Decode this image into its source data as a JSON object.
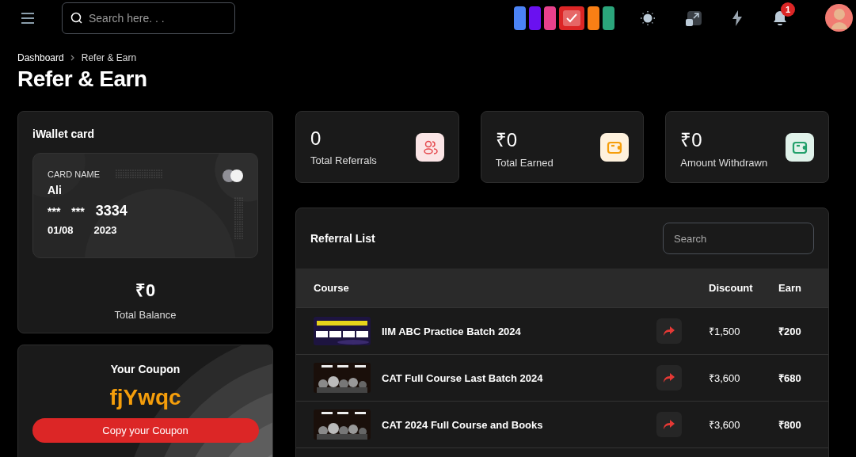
{
  "header": {
    "search": {
      "placeholder": "Search here. . ."
    },
    "themes": [
      {
        "color": "#4b83f5",
        "selected": false
      },
      {
        "color": "#6a11f0",
        "selected": false
      },
      {
        "color": "#e8418c",
        "selected": false
      },
      {
        "color": "#dc2626",
        "selected": true
      },
      {
        "color": "#f97f15",
        "selected": false
      },
      {
        "color": "#2ba57b",
        "selected": false
      }
    ],
    "notifications": {
      "count": "1"
    }
  },
  "breadcrumb": [
    "Dashboard",
    "Refer & Earn"
  ],
  "page_title": "Refer & Earn",
  "wallet": {
    "title": "iWallet card",
    "card_label": "CARD NAME",
    "holder": "Ali",
    "number_parts": [
      "***",
      "***",
      "3334"
    ],
    "expiry": "01/08",
    "year": "2023",
    "balance": "₹0",
    "balance_label": "Total Balance"
  },
  "coupon": {
    "title": "Your Coupon",
    "code": "fjYwqc",
    "button": "Copy your Coupon"
  },
  "stats": [
    {
      "value": "0",
      "label": "Total Referrals",
      "kind": "users",
      "color": "#e5484d"
    },
    {
      "value": "₹0",
      "label": "Total Earned",
      "kind": "wallet",
      "color": "#f59e0b"
    },
    {
      "value": "₹0",
      "label": "Amount Withdrawn",
      "kind": "wallet",
      "color": "#22a06b"
    }
  ],
  "referrals": {
    "title": "Referral List",
    "search": {
      "placeholder": "Search"
    },
    "columns": [
      "Course",
      "Discount",
      "Earn"
    ],
    "rows": [
      {
        "course": "IIM ABC Practice Batch 2024",
        "discount": "₹1,500",
        "earn": "₹200"
      },
      {
        "course": "CAT Full Course Last Batch 2024",
        "discount": "₹3,600",
        "earn": "₹680"
      },
      {
        "course": "CAT 2024 Full Course and Books",
        "discount": "₹3,600",
        "earn": "₹800"
      }
    ]
  }
}
